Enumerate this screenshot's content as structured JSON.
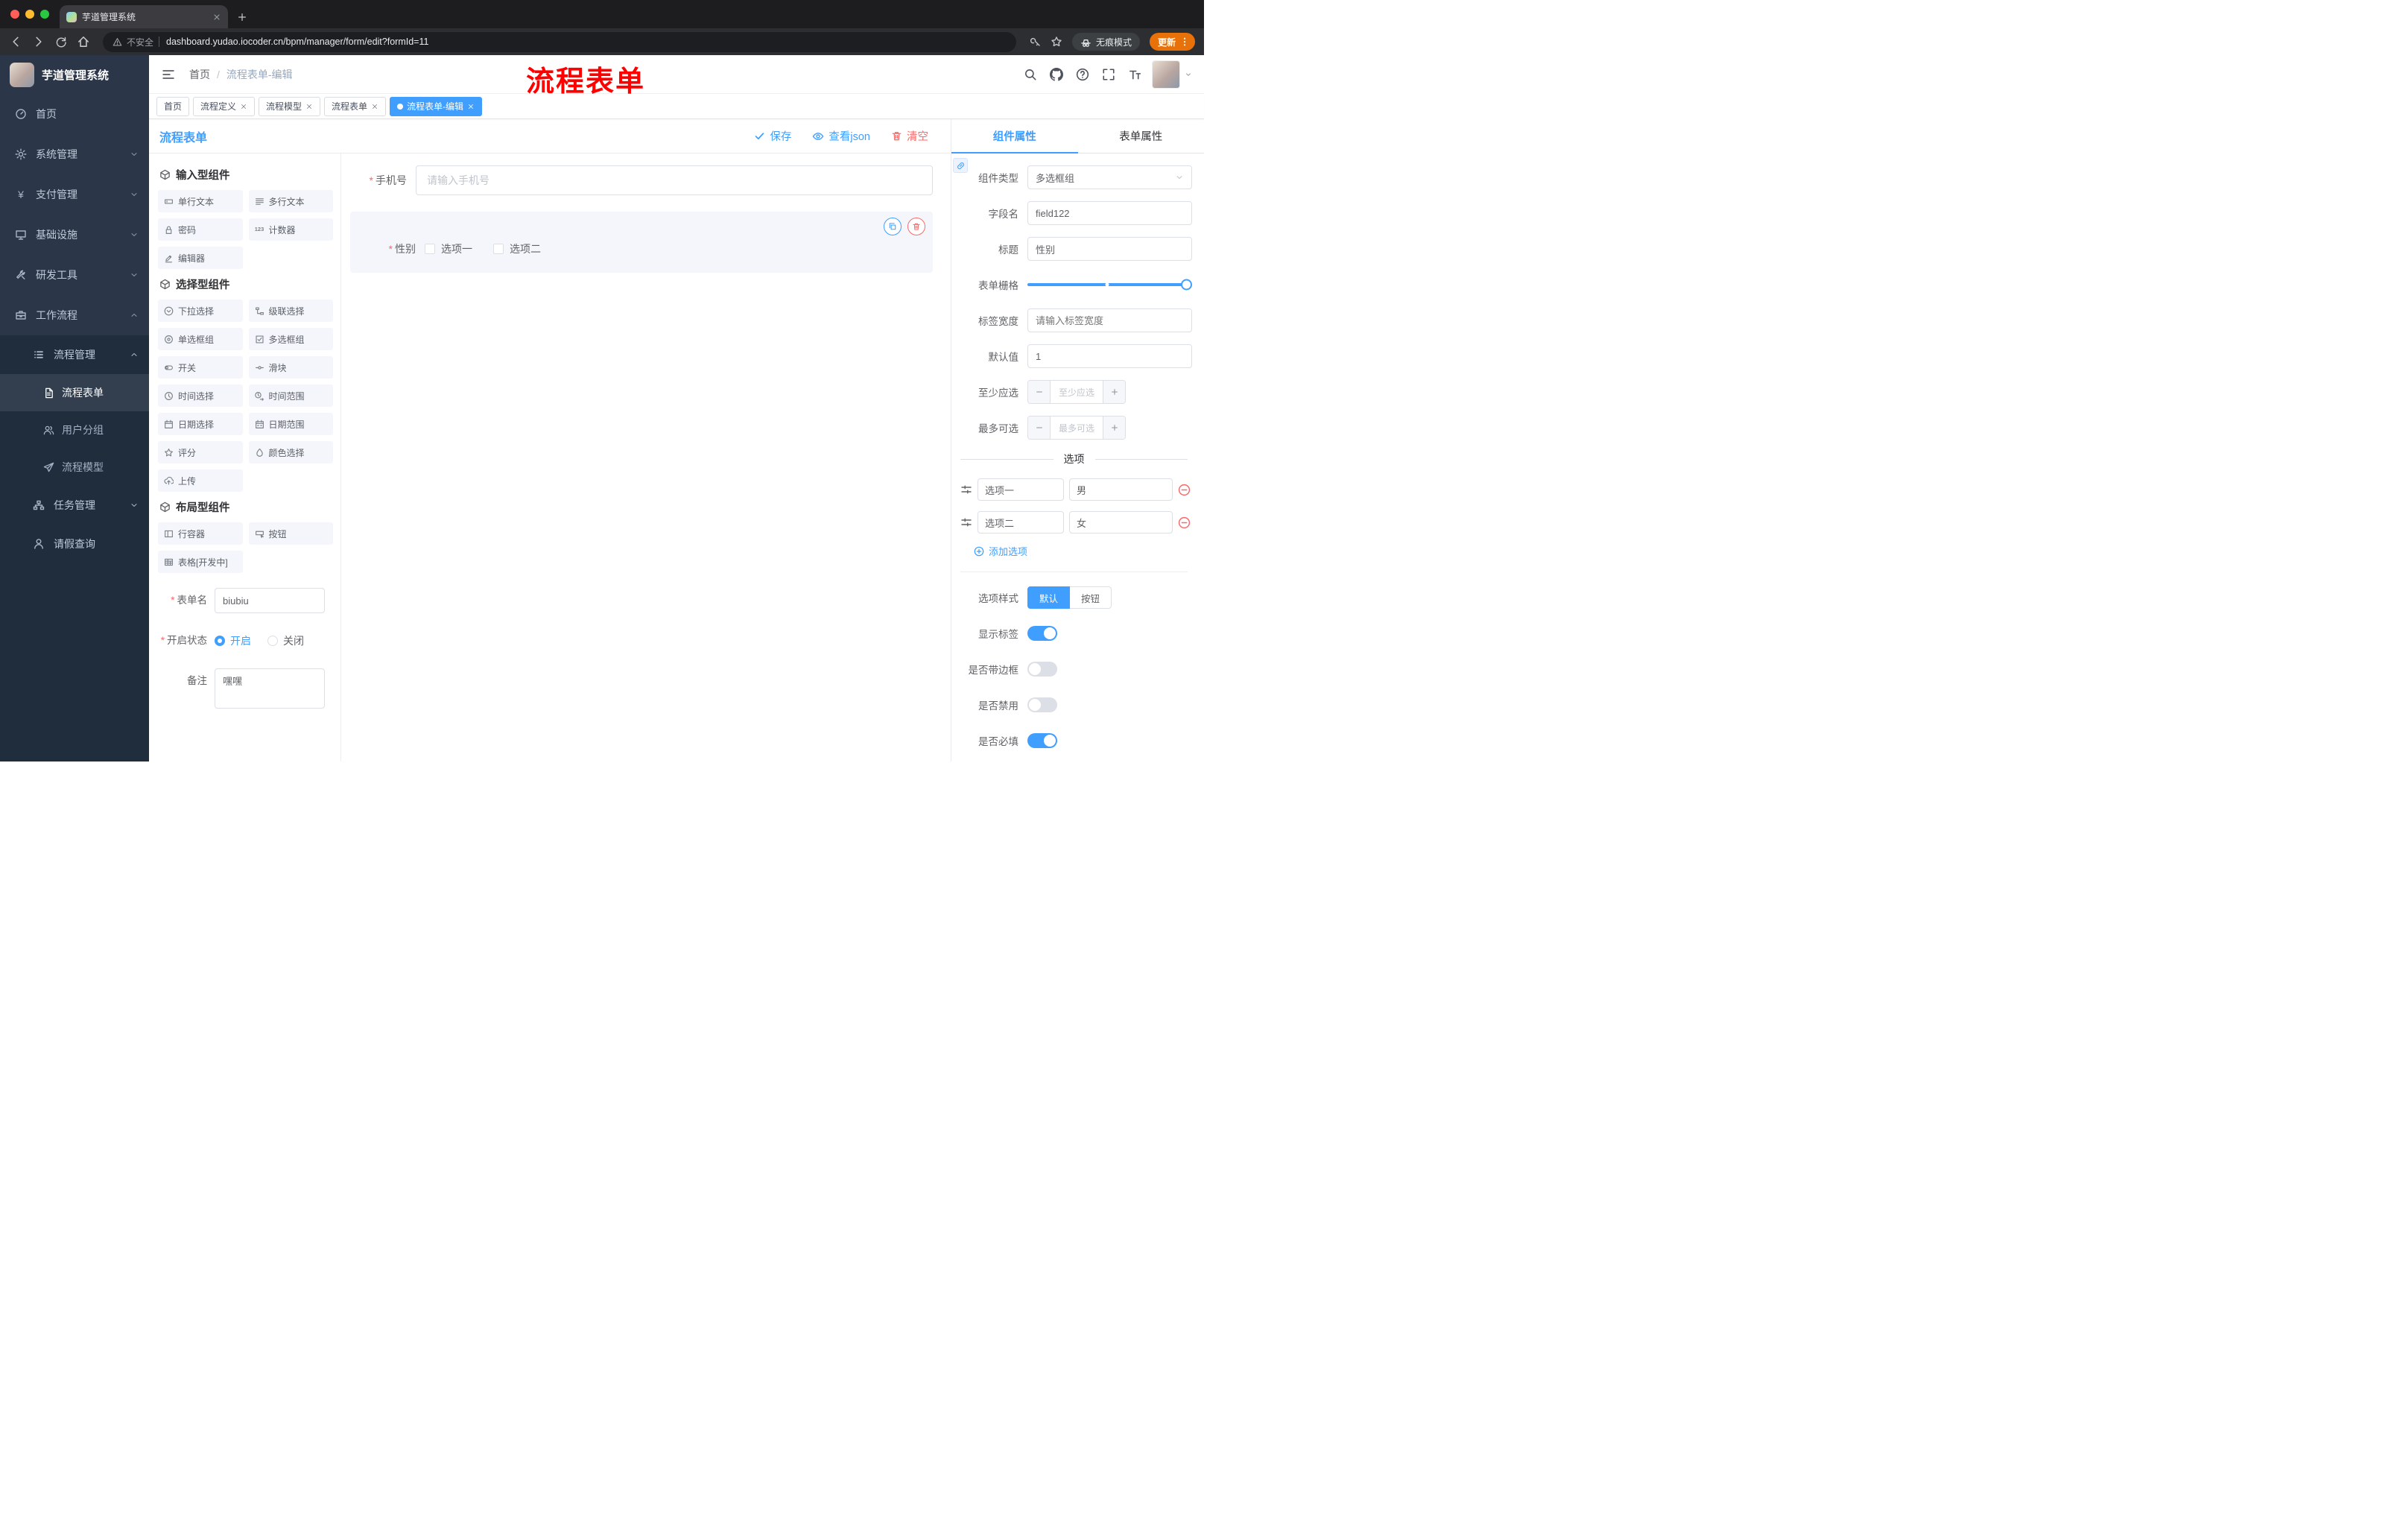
{
  "colors": {
    "accent": "#409EFF",
    "danger": "#F56C6C",
    "annotation_red": "#FF0000",
    "sidebar_bg": "#2B3648",
    "submenu_bg": "#1F2D3D"
  },
  "chrome": {
    "tab_title": "芋道管理系统",
    "security_label": "不安全",
    "url": "dashboard.yudao.iocoder.cn/bpm/manager/form/edit?formId=11",
    "incognito_label": "无痕模式",
    "update_label": "更新"
  },
  "sidebar": {
    "logo_title": "芋道管理系统",
    "top_items": [
      {
        "label": "首页",
        "icon": "dashboard",
        "chevron": ""
      },
      {
        "label": "系统管理",
        "icon": "gear",
        "chevron": "down"
      },
      {
        "label": "支付管理",
        "icon": "yen",
        "chevron": "down"
      },
      {
        "label": "基础设施",
        "icon": "monitor",
        "chevron": "down"
      },
      {
        "label": "研发工具",
        "icon": "tools",
        "chevron": "down"
      },
      {
        "label": "工作流程",
        "icon": "workflow",
        "chevron": "up"
      }
    ],
    "submenu": {
      "group_label": "流程管理",
      "group_icon": "process-list",
      "children": [
        {
          "label": "流程表单",
          "icon": "form-doc",
          "active": true
        },
        {
          "label": "用户分组",
          "icon": "user-group",
          "active": false
        },
        {
          "label": "流程模型",
          "icon": "paper-plane",
          "active": false
        }
      ],
      "siblings": [
        {
          "label": "任务管理",
          "icon": "task-tree",
          "chevron": "down"
        },
        {
          "label": "请假查询",
          "icon": "person",
          "chevron": ""
        }
      ]
    }
  },
  "header": {
    "breadcrumb_home": "首页",
    "breadcrumb_sep": "/",
    "breadcrumb_current": "流程表单-编辑",
    "annotation": "流程表单",
    "action_icons": [
      "search",
      "github",
      "help",
      "fullscreen",
      "font-size"
    ]
  },
  "tags": [
    {
      "label": "首页",
      "closable": false,
      "active": false
    },
    {
      "label": "流程定义",
      "closable": true,
      "active": false
    },
    {
      "label": "流程模型",
      "closable": true,
      "active": false
    },
    {
      "label": "流程表单",
      "closable": true,
      "active": false
    },
    {
      "label": "流程表单-编辑",
      "closable": true,
      "active": true
    }
  ],
  "designer": {
    "title": "流程表单",
    "save_label": "保存",
    "view_json_label": "查看json",
    "clear_label": "清空",
    "palette": {
      "groups": [
        {
          "title": "输入型组件",
          "items": [
            {
              "label": "单行文本",
              "icon": "input-single"
            },
            {
              "label": "多行文本",
              "icon": "input-multi"
            },
            {
              "label": "密码",
              "icon": "lock"
            },
            {
              "label": "计数器",
              "icon": "counter"
            },
            {
              "label": "编辑器",
              "icon": "editor"
            }
          ]
        },
        {
          "title": "选择型组件",
          "items": [
            {
              "label": "下拉选择",
              "icon": "select-down"
            },
            {
              "label": "级联选择",
              "icon": "cascade"
            },
            {
              "label": "单选框组",
              "icon": "radio"
            },
            {
              "label": "多选框组",
              "icon": "checkbox"
            },
            {
              "label": "开关",
              "icon": "switch"
            },
            {
              "label": "滑块",
              "icon": "slider"
            },
            {
              "label": "时间选择",
              "icon": "time"
            },
            {
              "label": "时间范围",
              "icon": "time-range"
            },
            {
              "label": "日期选择",
              "icon": "date"
            },
            {
              "label": "日期范围",
              "icon": "date-range"
            },
            {
              "label": "评分",
              "icon": "star"
            },
            {
              "label": "颜色选择",
              "icon": "color"
            },
            {
              "label": "上传",
              "icon": "upload"
            }
          ]
        },
        {
          "title": "布局型组件",
          "items": [
            {
              "label": "行容器",
              "icon": "row-container"
            },
            {
              "label": "按钮",
              "icon": "button"
            },
            {
              "label": "表格[开发中]",
              "icon": "table"
            }
          ]
        }
      ]
    },
    "meta": {
      "name_label": "表单名",
      "name_value": "biubiu",
      "status_label": "开启状态",
      "status_on": "开启",
      "status_off": "关闭",
      "status_selected": "开启",
      "remark_label": "备注",
      "remark_value": "嘿嘿"
    },
    "canvas": {
      "phone": {
        "label": "手机号",
        "required": true,
        "placeholder": "请输入手机号"
      },
      "gender": {
        "label": "性别",
        "required": true,
        "options": [
          "选项一",
          "选项二"
        ],
        "selected_widget": true
      }
    }
  },
  "props": {
    "tab_component": "组件属性",
    "tab_form": "表单属性",
    "active_tab": "组件属性",
    "rows": {
      "type_label": "组件类型",
      "type_value": "多选框组",
      "field_label": "字段名",
      "field_value": "field122",
      "title_label": "标题",
      "title_value": "性别",
      "grid_label": "表单栅格",
      "width_label": "标签宽度",
      "width_placeholder": "请输入标签宽度",
      "default_label": "默认值",
      "default_value": "1",
      "min_label": "至少应选",
      "min_placeholder": "至少应选",
      "max_label": "最多可选",
      "max_placeholder": "最多可选"
    },
    "options_title": "选项",
    "options": [
      {
        "name": "选项一",
        "value": "男"
      },
      {
        "name": "选项二",
        "value": "女"
      }
    ],
    "add_option_label": "添加选项",
    "style_label": "选项样式",
    "style_default": "默认",
    "style_button": "按钮",
    "style_selected": "默认",
    "toggles": [
      {
        "label": "显示标签",
        "on": true
      },
      {
        "label": "是否带边框",
        "on": false
      },
      {
        "label": "是否禁用",
        "on": false
      },
      {
        "label": "是否必填",
        "on": true
      }
    ]
  }
}
